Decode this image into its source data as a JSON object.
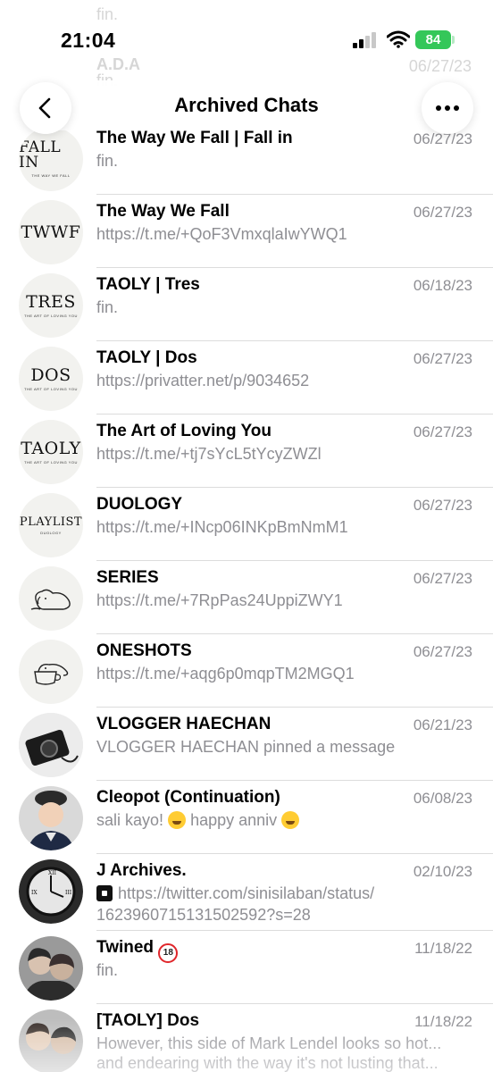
{
  "status": {
    "time": "21:04",
    "battery": "84"
  },
  "ghost_rows": [
    {
      "name": "",
      "sub": "fin.",
      "date": ""
    },
    {
      "name": "A.D.A",
      "sub": "fin.",
      "date": "06/27/23"
    }
  ],
  "header": {
    "title": "Archived Chats"
  },
  "chats": [
    {
      "name": "The Way We Fall | Fall in",
      "date": "06/27/23",
      "message": "fin.",
      "avatar_main": "FALL IN",
      "avatar_sub": "THE WAY WE FALL"
    },
    {
      "name": "The Way We Fall",
      "date": "06/27/23",
      "message": "https://t.me/+QoF3VmxqlaIwYWQ1",
      "avatar_main": "TWWF",
      "avatar_sub": ""
    },
    {
      "name": "TAOLY | Tres",
      "date": "06/18/23",
      "message": "fin.",
      "avatar_main": "TRES",
      "avatar_sub": "THE ART OF LOVING YOU"
    },
    {
      "name": "TAOLY | Dos",
      "date": "06/27/23",
      "message": "https://privatter.net/p/9034652",
      "avatar_main": "DOS",
      "avatar_sub": "THE ART OF LOVING YOU"
    },
    {
      "name": "The Art of Loving You",
      "date": "06/27/23",
      "message": "https://t.me/+tj7sYcL5tYcyZWZl",
      "avatar_main": "TAOLY",
      "avatar_sub": "THE ART OF LOVING YOU"
    },
    {
      "name": "DUOLOGY",
      "date": "06/27/23",
      "message": "https://t.me/+INcp06INKpBmNmM1",
      "avatar_main": "PLAYLIST",
      "avatar_sub": "DUOLOGY"
    },
    {
      "name": "SERIES",
      "date": "06/27/23",
      "message": "https://t.me/+7RpPas24UppiZWY1",
      "avatar_icon": "sleeping-dog-icon"
    },
    {
      "name": "ONESHOTS",
      "date": "06/27/23",
      "message": "https://t.me/+aqg6p0mqpTM2MGQ1",
      "avatar_icon": "dog-in-cup-icon"
    },
    {
      "name": "VLOGGER HAECHAN",
      "date": "06/21/23",
      "message": "VLOGGER HAECHAN pinned a message",
      "avatar_icon": "camera-photo"
    },
    {
      "name": "Cleopot (Continuation)",
      "date": "06/08/23",
      "message_a": "sali kayo!",
      "message_b": "happy anniv",
      "avatar_icon": "child-portrait-photo"
    },
    {
      "name": "J Archives.",
      "date": "02/10/23",
      "message": "https://twitter.com/sinisilaban/status/",
      "message_line2": "1623960715131502592?s=28",
      "avatar_icon": "clock-photo"
    },
    {
      "name": "Twined",
      "badge": "18",
      "date": "11/18/22",
      "message": "fin.",
      "avatar_icon": "couple-photo"
    },
    {
      "name": "[TAOLY] Dos",
      "date": "11/18/22",
      "message": "However, this side of Mark Lendel looks so hot...",
      "message_line2": "and endearing with the way it's not lusting that...",
      "avatar_icon": "couple-photo-2"
    }
  ]
}
